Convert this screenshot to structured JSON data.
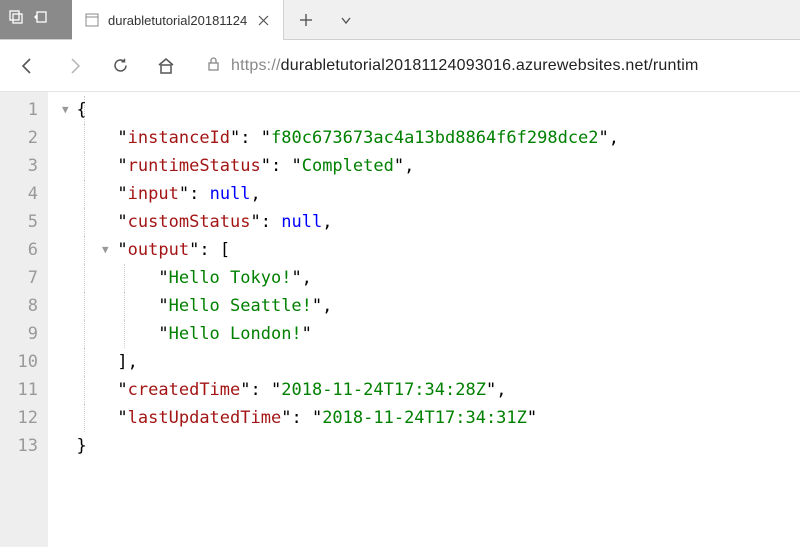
{
  "titlebar": {
    "tab_title": "durabletutorial20181124"
  },
  "toolbar": {
    "url_proto": "https://",
    "url_rest": "durabletutorial20181124093016.azurewebsites.net/runtim"
  },
  "json": {
    "keys": {
      "instanceId": "instanceId",
      "runtimeStatus": "runtimeStatus",
      "input": "input",
      "customStatus": "customStatus",
      "output": "output",
      "createdTime": "createdTime",
      "lastUpdatedTime": "lastUpdatedTime"
    },
    "values": {
      "instanceId": "f80c673673ac4a13bd8864f6f298dce2",
      "runtimeStatus": "Completed",
      "input": "null",
      "customStatus": "null",
      "output": [
        "Hello Tokyo!",
        "Hello Seattle!",
        "Hello London!"
      ],
      "createdTime": "2018-11-24T17:34:28Z",
      "lastUpdatedTime": "2018-11-24T17:34:31Z"
    }
  },
  "line_numbers": [
    "1",
    "2",
    "3",
    "4",
    "5",
    "6",
    "7",
    "8",
    "9",
    "10",
    "11",
    "12",
    "13"
  ]
}
